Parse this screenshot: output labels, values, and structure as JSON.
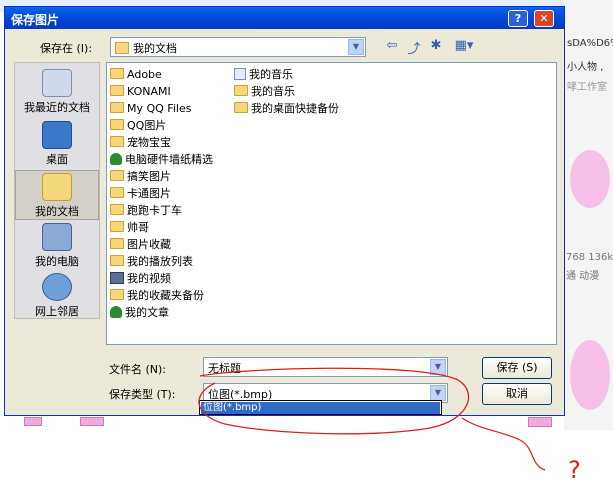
{
  "background": {
    "right_texts": [
      "sDA%D6%",
      "小人物 ,",
      "哮工作室",
      "768 136k",
      "通 动漫"
    ]
  },
  "dialog": {
    "title": "保存图片",
    "help_label": "?",
    "close_label": "✕",
    "save_in_label": "保存在 (I):",
    "save_in_value": "我的文档",
    "places": [
      {
        "label": "我最近的文档",
        "icon": "recent-documents-icon"
      },
      {
        "label": "桌面",
        "icon": "desktop-icon"
      },
      {
        "label": "我的文档",
        "icon": "my-documents-icon"
      },
      {
        "label": "我的电脑",
        "icon": "my-computer-icon"
      },
      {
        "label": "网上邻居",
        "icon": "network-places-icon"
      }
    ],
    "files_col1": [
      {
        "name": "Adobe",
        "type": "folder"
      },
      {
        "name": "KONAMI",
        "type": "folder"
      },
      {
        "name": "My QQ Files",
        "type": "folder"
      },
      {
        "name": "QQ图片",
        "type": "folder"
      },
      {
        "name": "宠物宝宝",
        "type": "folder"
      },
      {
        "name": "电脑硬件墙纸精选",
        "type": "tree"
      },
      {
        "name": "搞笑图片",
        "type": "folder"
      },
      {
        "name": "卡通图片",
        "type": "folder"
      },
      {
        "name": "跑跑卡丁车",
        "type": "folder"
      },
      {
        "name": "帅哥",
        "type": "folder"
      },
      {
        "name": "图片收藏",
        "type": "folder"
      },
      {
        "name": "我的播放列表",
        "type": "folder"
      },
      {
        "name": "我的视频",
        "type": "video"
      },
      {
        "name": "我的收藏夹备份",
        "type": "folder"
      },
      {
        "name": "我的文章",
        "type": "tree"
      }
    ],
    "files_col2": [
      {
        "name": "我的音乐",
        "type": "media"
      },
      {
        "name": "我的音乐",
        "type": "folder"
      },
      {
        "name": "我的桌面快捷备份",
        "type": "folder"
      }
    ],
    "filename_label": "文件名 (N):",
    "filename_value": "无标题",
    "filetype_label": "保存类型 (T):",
    "filetype_value": "位图(*.bmp)",
    "filetype_options": [
      "位图(*.bmp)"
    ],
    "save_button": "保存 (S)",
    "cancel_button": "取消"
  },
  "annotation": {
    "question_mark": "?",
    "color": "#d9201a"
  }
}
